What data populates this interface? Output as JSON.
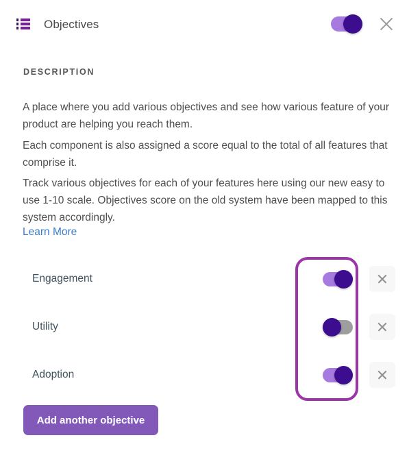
{
  "header": {
    "icon": "list-icon",
    "title": "Objectives",
    "toggle": {
      "state": "on",
      "label": "Objectives enabled"
    },
    "close": {
      "icon": "close-icon",
      "label": "Close"
    }
  },
  "description": {
    "section_label": "DESCRIPTION",
    "paragraphs": [
      "A place where you add various objectives and see how various feature of your product are helping you reach them.",
      "Each component is also assigned a score equal to the total of all features that comprise it.",
      "Track various objectives for each of your features here using our new easy to use 1-10 scale. Objectives score on the old system have been mapped to this system accordingly."
    ],
    "learn_more": "Learn More"
  },
  "objectives": [
    {
      "label": "Engagement",
      "toggle": "on",
      "delete_icon": "close-icon"
    },
    {
      "label": "Utility",
      "toggle": "off",
      "delete_icon": "close-icon"
    },
    {
      "label": "Adoption",
      "toggle": "on",
      "delete_icon": "close-icon"
    }
  ],
  "annotation": {
    "name": "toggle-column-highlight",
    "color": "#9c35a8"
  },
  "actions": {
    "add_objective": "Add another objective"
  },
  "colors": {
    "toggle_on_track": "#a77ae0",
    "toggle_off_track": "#9e9e9e",
    "toggle_knob": "#3d0d8f",
    "primary_button": "#8259b8",
    "link": "#3d7cc9",
    "icon_accent": "#7b1fa2",
    "highlight": "#9c35a8"
  }
}
